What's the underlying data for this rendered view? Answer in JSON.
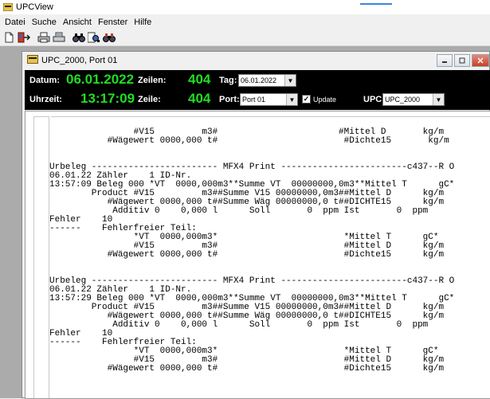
{
  "app": {
    "title": "UPCView",
    "accent_color": "#3b86d6"
  },
  "menu": [
    "Datei",
    "Suche",
    "Ansicht",
    "Fenster",
    "Hilfe"
  ],
  "toolbar": [
    "new-document-icon",
    "exit-icon",
    "print-icon",
    "print-preview-icon",
    "find-icon",
    "find-next-icon",
    "find-binoculars-icon"
  ],
  "child": {
    "title": "UPC_2000, Port 01",
    "buttons": [
      "minimize-icon",
      "restore-icon",
      "close-icon"
    ]
  },
  "info": {
    "datum_label": "Datum:",
    "datum_value": "06.01.2022",
    "zeilen_label": "Zeilen:",
    "zeilen_value": "404",
    "tag_label": "Tag:",
    "tag_value": "06.01.2022",
    "uhrzeit_label": "Uhrzeit:",
    "uhrzeit_value": "13:17:09",
    "zeile_label": "Zeile:",
    "zeile_value": "404",
    "port_label": "Port:",
    "port_value": "Port 01",
    "update_label": "Update",
    "update_checked": true,
    "upc_label": "UPC:",
    "upc_value": "UPC_2000",
    "value_color": "#22dd22"
  },
  "document": {
    "lines": [
      "                #V15         m3#                       #Mittel D       kg/m",
      "           #Wägewert 0000,000 t#                        #Dichte15       kg/m",
      "",
      "",
      "Urbeleg ------------------------ MFX4 Print ------------------------c437--R O",
      "06.01.22 Zähler    1 ID-Nr.",
      "13:57:09 Beleg 000 *VT  0000,000m3**Summe VT  00000000,0m3**Mittel T      gC*",
      "        Product #V15         m3##Summe V15 00000000,0m3##Mittel D      kg/m",
      "           #Wägewert 0000,000 t##Summe Wäg 00000000,0 t##DICHTE15      kg/m",
      "            Additiv 0    0,000 l      Soll       0  ppm Ist       0  ppm",
      "Fehler    10",
      "------    Fehlerfreier Teil:",
      "                *VT  0000,000m3*                        *Mittel T      gC*",
      "                #V15         m3#                        #Mittel D      kg/m",
      "           #Wägewert 0000,000 t#                        #Dichte15      kg/m",
      "",
      "",
      "Urbeleg ------------------------ MFX4 Print ------------------------c437--R O",
      "06.01.22 Zähler    1 ID-Nr.",
      "13:57:29 Beleg 000 *VT  0000,000m3**Summe VT  00000000,0m3**Mittel T      gC*",
      "        Product #V15         m3##Summe V15 00000000,0m3##Mittel D      kg/m",
      "           #Wägewert 0000,000 t##Summe Wäg 00000000,0 t##DICHTE15      kg/m",
      "            Additiv 0    0,000 l      Soll       0  ppm Ist       0  ppm",
      "Fehler    10",
      "------    Fehlerfreier Teil:",
      "                *VT  0000,000m3*                        *Mittel T      gC*",
      "                #V15         m3#                        #Mittel D      kg/m",
      "           #Wägewert 0000,000 t#                        #Dichte15      kg/m"
    ]
  }
}
